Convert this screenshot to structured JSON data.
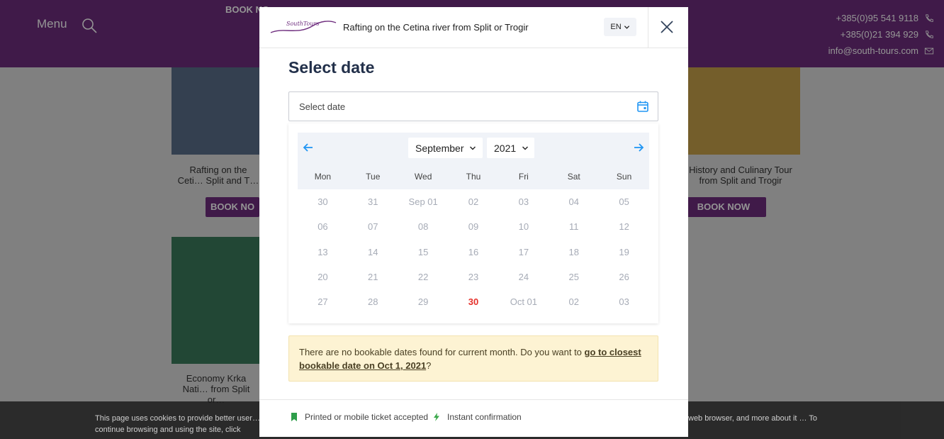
{
  "background": {
    "header": {
      "menu_label": "Menu",
      "phone_1": "+385(0)95 541 9118",
      "phone_2": "+385(0)21 394 929",
      "email": "info@south-tours.com"
    },
    "tiles": [
      {
        "caption": "Rafting on the Ceti… Split and T…",
        "button": "BOOK NO"
      },
      {
        "caption": "History and Culinary Tour from Split and Trogir",
        "button": "BOOK NOW"
      },
      {
        "caption": "Economy Krka Nati… from Split or…",
        "button": ""
      }
    ],
    "top_button": "BOOK NO",
    "cookie_left": "This page uses cookies to provide better user… continue browsing and using the site, click",
    "cookie_right": "web browser, and more about it … To"
  },
  "modal": {
    "brand": "SouthTours",
    "title": "Rafting on the Cetina river from Split or Trogir",
    "language": "EN",
    "section_title": "Select date",
    "date_input": {
      "value": "Select date"
    },
    "calendar": {
      "month": "September",
      "year": "2021",
      "weekdays": [
        "Mon",
        "Tue",
        "Wed",
        "Thu",
        "Fri",
        "Sat",
        "Sun"
      ],
      "weeks": [
        [
          "30",
          "31",
          "Sep 01",
          "02",
          "03",
          "04",
          "05"
        ],
        [
          "06",
          "07",
          "08",
          "09",
          "10",
          "11",
          "12"
        ],
        [
          "13",
          "14",
          "15",
          "16",
          "17",
          "18",
          "19"
        ],
        [
          "20",
          "21",
          "22",
          "23",
          "24",
          "25",
          "26"
        ],
        [
          "27",
          "28",
          "29",
          "30",
          "Oct 01",
          "02",
          "03"
        ]
      ],
      "today": {
        "week": 4,
        "day": 3
      }
    },
    "notice": {
      "text": "There are no bookable dates found for current month. Do you want to ",
      "link": "go to closest bookable date on Oct 1, 2021",
      "suffix": "?"
    },
    "footer": {
      "feature_1": "Printed or mobile ticket accepted",
      "feature_2": "Instant confirmation"
    },
    "colors": {
      "accent": "#2196f3",
      "today": "#e5302a",
      "brand": "#6e2d7e",
      "ticket_icon": "#2e9e4a",
      "bolt_icon": "#3aa84a"
    }
  }
}
